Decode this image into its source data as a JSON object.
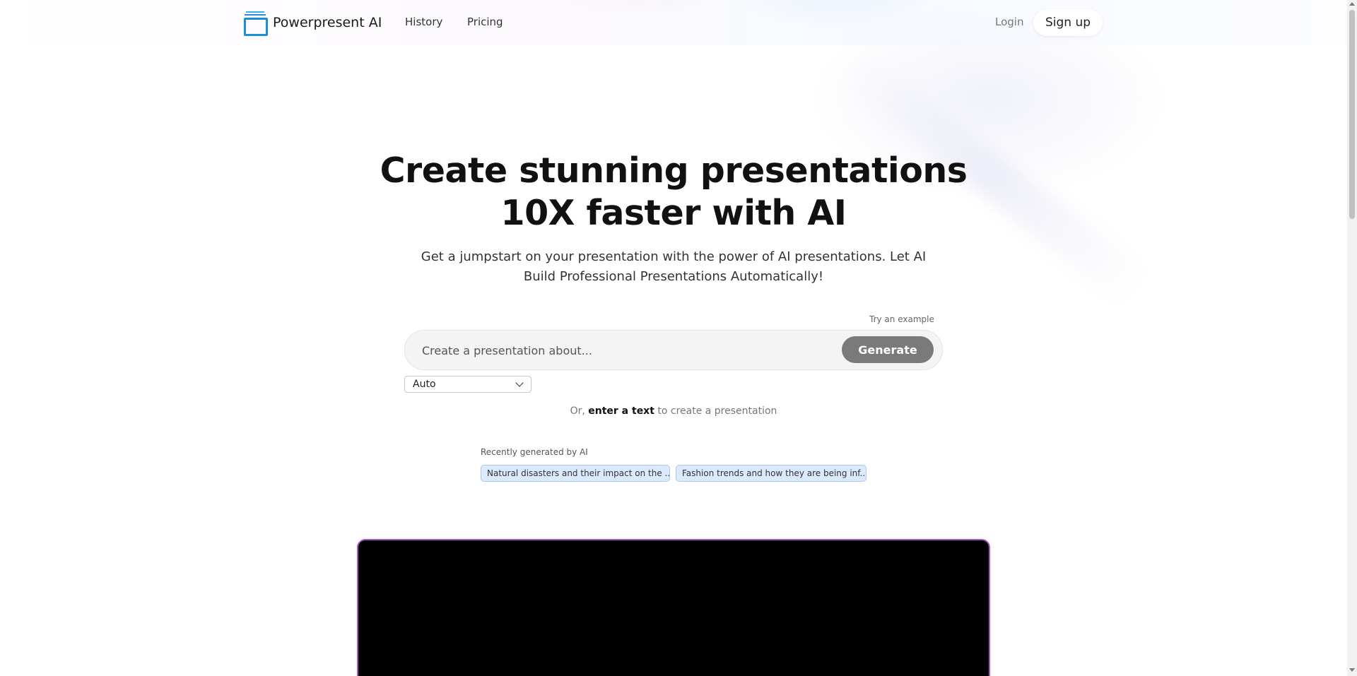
{
  "header": {
    "brand": "Powerpresent AI",
    "nav": {
      "history": "History",
      "pricing": "Pricing"
    },
    "login": "Login",
    "signup": "Sign up"
  },
  "hero": {
    "title_line1": "Create stunning presentations",
    "title_line2": "10X faster with AI",
    "subtitle": "Get a jumpstart on your presentation with the power of AI presentations. Let AI Build Professional Presentations Automatically!"
  },
  "prompt": {
    "try_example": "Try an example",
    "placeholder": "Create a presentation about...",
    "value": "",
    "generate": "Generate",
    "mode_selected": "Auto"
  },
  "alt_action": {
    "prefix": "Or,",
    "link": "enter a text",
    "suffix": "to create a presentation"
  },
  "recent": {
    "label": "Recently generated by AI",
    "items": [
      "Natural disasters and their impact on the ...",
      "Fashion trends and how they are being inf..."
    ]
  },
  "colors": {
    "accent_blue": "#1c8fd9",
    "generate_bg": "#7a7a7a",
    "chip_bg": "#dbeafe",
    "video_border": "#a855c8"
  }
}
